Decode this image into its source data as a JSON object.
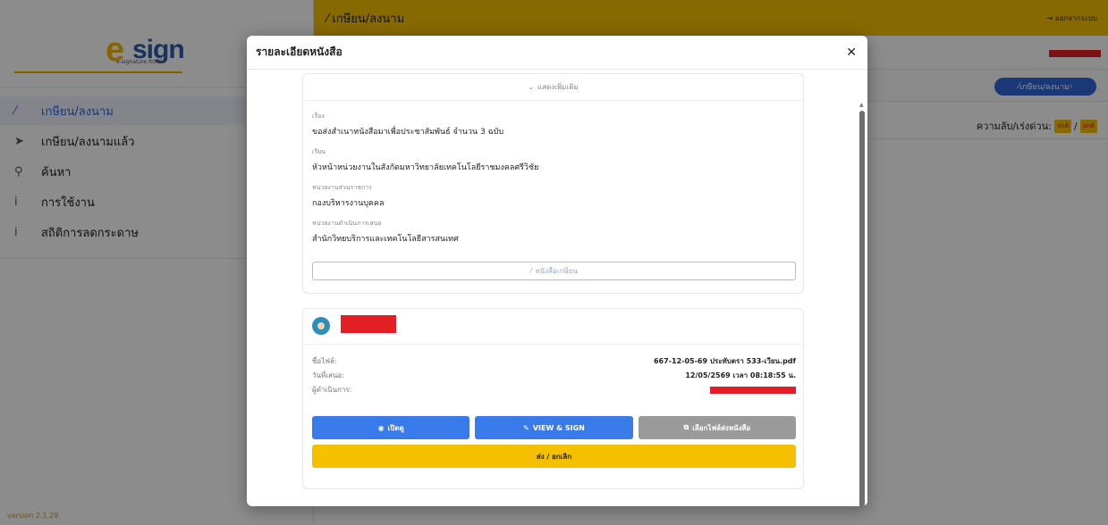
{
  "app": {
    "version": "version 2.1.29",
    "logo_text_e": "e",
    "logo_text_sign": "sign",
    "logo_sub": "e-signature RUTS"
  },
  "sidebar": {
    "items": [
      {
        "icon": "pen-icon",
        "label": "เกษียน/ลงนาม"
      },
      {
        "icon": "send-icon",
        "label": "เกษียน/ลงนามแล้ว"
      },
      {
        "icon": "search-icon",
        "label": "ค้นหา"
      },
      {
        "icon": "info-icon",
        "label": "การใช้งาน"
      },
      {
        "icon": "info-icon",
        "label": "สถิติการลดกระดาษ"
      }
    ]
  },
  "header": {
    "title": "เกษียน/ลงนาม",
    "logout_label": "ออกจากระบบ",
    "action_button_label": "เกษียน/ลงนาม",
    "secrecy_label": "ความลับ/เร่งด่วน:",
    "secrecy_tag_1": "ปกติ",
    "secrecy_separator": "/",
    "secrecy_tag_2": "ปกติ"
  },
  "modal": {
    "title": "รายละเอียดหนังสือ",
    "show_more_label": "แสดงเพิ่มเติม",
    "fields": [
      {
        "label": "เรื่อง",
        "value": "ขอส่งสำเนาหนังสือมาเพื่อประชาสัมพันธ์ จำนวน 3 ฉบับ"
      },
      {
        "label": "เรียน",
        "value": "หัวหน้าหน่วยงานในสังกัดมหาวิทยาลัยเทคโนโลยีราชมงคลศรีวิชัย"
      },
      {
        "label": "หน่วยงานส่วนราชการ",
        "value": "กองบริหารงานบุคคล"
      },
      {
        "label": "หน่วยงานดำเนินการเสนอ",
        "value": "สำนักวิทยบริการและเทคโนโลยีสารสนเทศ"
      }
    ],
    "letter_button_label": "หนังสือเกษียน",
    "file_info": {
      "filename_label": "ชื่อไฟล์:",
      "filename_value": "667-12-05-69 ประทับตรา 533-เวียน.pdf",
      "date_label": "วันที่เสนอ:",
      "date_value": "12/05/2569 เวลา 08:18:55 น.",
      "operator_label": "ผู้ดำเนินการ:"
    },
    "buttons": {
      "open_label": "เปิดดู",
      "view_sign_label": "VIEW & SIGN",
      "attach_label": "เลือกไฟล์ส่งหนังสือ",
      "send_cancel_label": "ส่ง / ยกเลิก"
    }
  },
  "colors": {
    "brand_yellow": "#f5c000",
    "primary_blue": "#3a7bec",
    "redaction": "#e31e24"
  }
}
